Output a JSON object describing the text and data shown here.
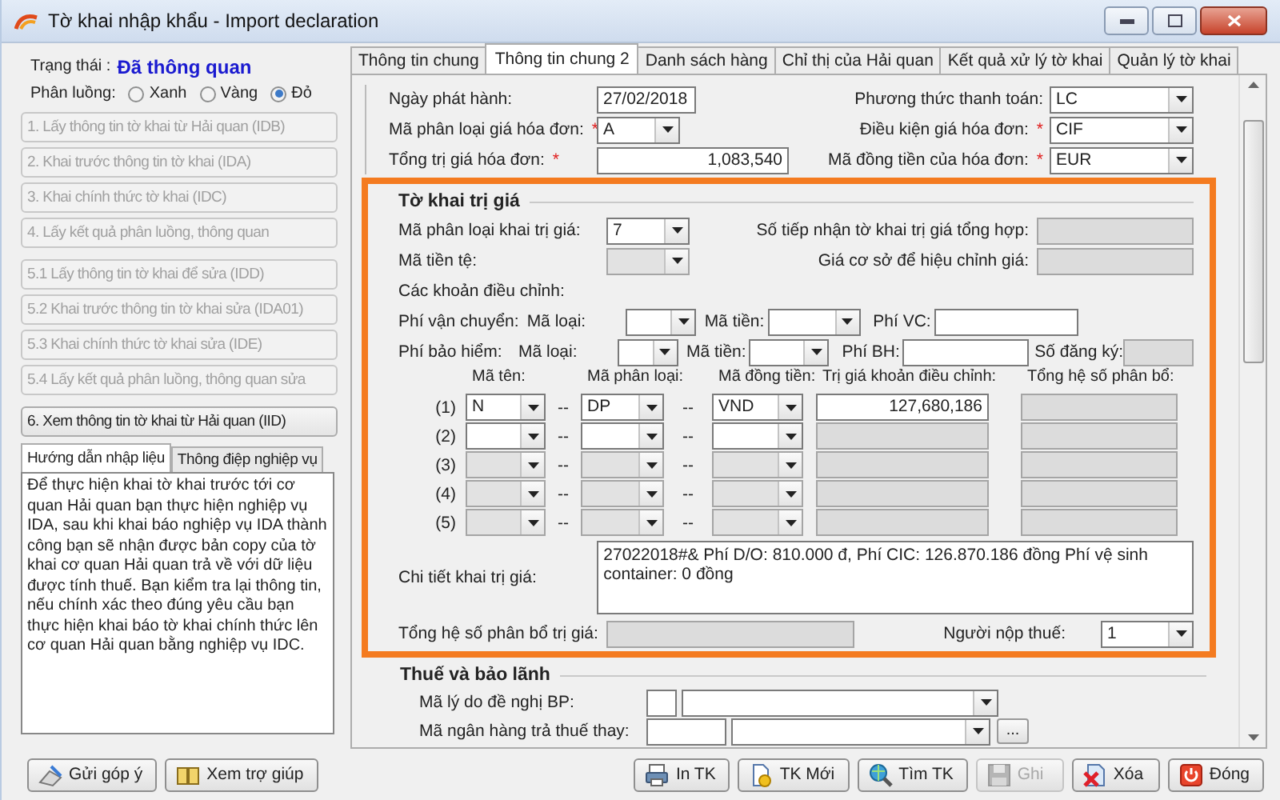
{
  "window": {
    "title": "Tờ khai nhập khẩu - Import declaration"
  },
  "status": {
    "label": "Trạng thái :",
    "value": "Đã thông quan"
  },
  "lane": {
    "label": "Phân luồng:",
    "options": [
      {
        "label": "Xanh",
        "selected": false
      },
      {
        "label": "Vàng",
        "selected": false
      },
      {
        "label": "Đỏ",
        "selected": true
      }
    ]
  },
  "step_groups": [
    [
      {
        "label": "1. Lấy thông tin tờ khai từ Hải quan (IDB)",
        "disabled": true
      },
      {
        "label": "2. Khai trước thông tin tờ khai (IDA)",
        "disabled": true
      },
      {
        "label": "3. Khai chính thức tờ khai (IDC)",
        "disabled": true
      },
      {
        "label": "4. Lấy kết quả phân luồng, thông quan",
        "disabled": true
      }
    ],
    [
      {
        "label": "5.1 Lấy thông tin tờ khai để sửa (IDD)",
        "disabled": true
      },
      {
        "label": "5.2 Khai trước thông tin tờ khai sửa (IDA01)",
        "disabled": true
      },
      {
        "label": "5.3 Khai chính thức tờ khai sửa (IDE)",
        "disabled": true
      },
      {
        "label": "5.4 Lấy kết quả phân luồng, thông quan sửa",
        "disabled": true
      }
    ],
    [
      {
        "label": "6. Xem thông tin tờ khai từ Hải quan (IID)",
        "disabled": false
      }
    ]
  ],
  "guide_tabs": [
    {
      "label": "Hướng dẫn nhập liệu",
      "selected": true
    },
    {
      "label": "Thông điệp nghiệp vụ",
      "selected": false
    }
  ],
  "guide_text": "Để thực hiện khai tờ khai trước tới cơ quan Hải quan bạn thực hiện nghiệp vụ IDA, sau khi khai báo nghiệp vụ IDA thành công bạn sẽ nhận được bản copy của tờ khai cơ quan Hải quan trả về với dữ liệu được tính thuế. Bạn kiểm tra lại thông tin, nếu chính xác theo đúng yêu cầu bạn thực hiện khai báo tờ khai chính thức lên cơ quan Hải quan bằng nghiệp vụ IDC.",
  "tabs": [
    {
      "label": "Thông tin chung",
      "selected": false
    },
    {
      "label": "Thông tin chung 2",
      "selected": true
    },
    {
      "label": "Danh sách hàng",
      "selected": false
    },
    {
      "label": "Chỉ thị của Hải quan",
      "selected": false
    },
    {
      "label": "Kết quả xử lý tờ khai",
      "selected": false
    },
    {
      "label": "Quản lý tờ khai",
      "selected": false
    }
  ],
  "invoice": {
    "left": [
      {
        "kind": "date",
        "label": "Ngày phát hành:",
        "value": "27/02/2018"
      },
      {
        "kind": "combo",
        "label": "Mã phân loại giá hóa đơn:",
        "required_mark": "*",
        "value": "A"
      },
      {
        "kind": "number",
        "label": "Tổng trị giá hóa đơn:",
        "required_mark": "*",
        "value": "1,083,540"
      }
    ],
    "right": [
      {
        "label": "Phương thức thanh toán:",
        "value": "LC"
      },
      {
        "label": "Điều kiện giá hóa đơn:",
        "required_mark": "*",
        "value": "CIF"
      },
      {
        "label": "Mã đồng tiền của hóa đơn:",
        "required_mark": "*",
        "value": "EUR"
      }
    ]
  },
  "valuation": {
    "title": "Tờ khai trị giá",
    "classification": {
      "label": "Mã phân loại khai trị giá:",
      "value": "7"
    },
    "currency": {
      "label": "Mã tiền tệ:",
      "disabled": true
    },
    "summary_number": {
      "label": "Số tiếp nhận tờ khai trị giá tổng hợp:",
      "disabled": true
    },
    "base_price": {
      "label": "Giá cơ sở để hiệu chỉnh giá:",
      "disabled": true
    },
    "adjustments_label": "Các khoản điều chỉnh:",
    "freight": {
      "label": "Phí vận chuyển:",
      "type_label": "Mã loại:",
      "currency_label": "Mã tiền:",
      "amount_label": "Phí VC:"
    },
    "insurance": {
      "label": "Phí bảo hiểm:",
      "type_label": "Mã loại:",
      "currency_label": "Mã tiền:",
      "amount_label": "Phí BH:",
      "registration_label": "Số đăng ký:",
      "registration_disabled": true
    },
    "columns": [
      "Mã tên:",
      "Mã phân loại:",
      "Mã đồng tiền:",
      "Trị giá khoản điều chỉnh:",
      "Tổng hệ số phân bổ:"
    ],
    "separator": "--",
    "rows": [
      {
        "index": "(1)",
        "name": "N",
        "type": "DP",
        "currency": "VND",
        "amount": "127,680,186",
        "disabled": false
      },
      {
        "index": "(2)",
        "disabled": false
      },
      {
        "index": "(3)",
        "disabled": true
      },
      {
        "index": "(4)",
        "disabled": true
      },
      {
        "index": "(5)",
        "disabled": true
      }
    ],
    "detail": {
      "label": "Chi tiết khai trị giá:",
      "value": "27022018#& Phí D/O: 810.000 đ, Phí CIC: 126.870.186 đồng Phí vệ sinh container: 0 đồng"
    },
    "total_ratio": {
      "label": "Tổng hệ số phân bổ trị giá:",
      "disabled": true
    },
    "taxpayer": {
      "label": "Người nộp thuế:",
      "value": "1"
    }
  },
  "tax": {
    "title": "Thuế và bảo lãnh",
    "fields": [
      {
        "kind": "reason",
        "label": "Mã lý do đề nghị BP:"
      },
      {
        "kind": "bank",
        "label": "Mã ngân hàng trả thuế thay:",
        "more": "..."
      }
    ]
  },
  "buttons_left": [
    {
      "label": "Gửi góp ý"
    },
    {
      "label": "Xem trợ giúp"
    }
  ],
  "buttons_right": [
    {
      "label": "In TK",
      "disabled": false
    },
    {
      "label": "TK Mới",
      "disabled": false
    },
    {
      "label": "Tìm TK",
      "disabled": false
    },
    {
      "label": "Ghi",
      "disabled": true
    },
    {
      "label": "Xóa",
      "disabled": false
    },
    {
      "label": "Đóng",
      "disabled": false
    }
  ]
}
